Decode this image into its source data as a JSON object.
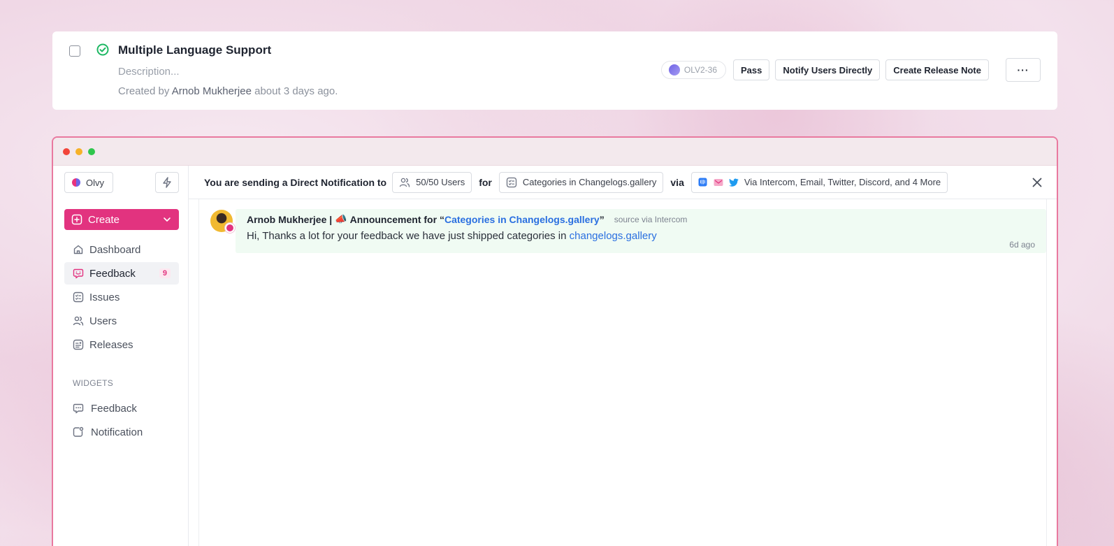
{
  "task": {
    "title": "Multiple Language Support",
    "description_placeholder": "Description...",
    "meta_prefix": "Created by",
    "author": "Arnob Mukherjee",
    "meta_suffix": "about 3 days ago.",
    "id_label": "OLV2-36",
    "actions": {
      "pass": "Pass",
      "notify": "Notify Users Directly",
      "release_note": "Create Release Note",
      "more": "···"
    }
  },
  "sidebar": {
    "workspace": "Olvy",
    "create_label": "Create",
    "items": [
      {
        "label": "Dashboard",
        "icon": "home-icon"
      },
      {
        "label": "Feedback",
        "icon": "feedback-icon",
        "badge": "9",
        "active": true
      },
      {
        "label": "Issues",
        "icon": "issues-icon"
      },
      {
        "label": "Users",
        "icon": "users-icon"
      },
      {
        "label": "Releases",
        "icon": "releases-icon"
      }
    ],
    "widgets_label": "WIDGETS",
    "widgets": [
      {
        "label": "Feedback",
        "icon": "chat-icon"
      },
      {
        "label": "Notification",
        "icon": "notification-icon"
      }
    ]
  },
  "notify_bar": {
    "lead": "You are sending a Direct Notification to",
    "users_chip": "50/50 Users",
    "for": "for",
    "category_chip": "Categories in Changelogs.gallery",
    "via": "via",
    "channels_chip": "Via Intercom, Email, Twitter, Discord, and 4 More"
  },
  "message": {
    "author": "Arnob Mukherjee |",
    "emoji": "📣",
    "announcement_prefix": "Announcement for “",
    "announcement_link": "Categories in Changelogs.gallery",
    "announcement_suffix": "”",
    "source": "source via Intercom",
    "body_text": "Hi, Thanks a lot for your feedback we have just shipped categories in",
    "body_link": "changelogs.gallery",
    "time": "6d ago"
  },
  "colors": {
    "accent": "#e2337f",
    "link": "#2a6fe0",
    "window_border": "#e9799f",
    "message_bg": "#f0fbf3"
  }
}
